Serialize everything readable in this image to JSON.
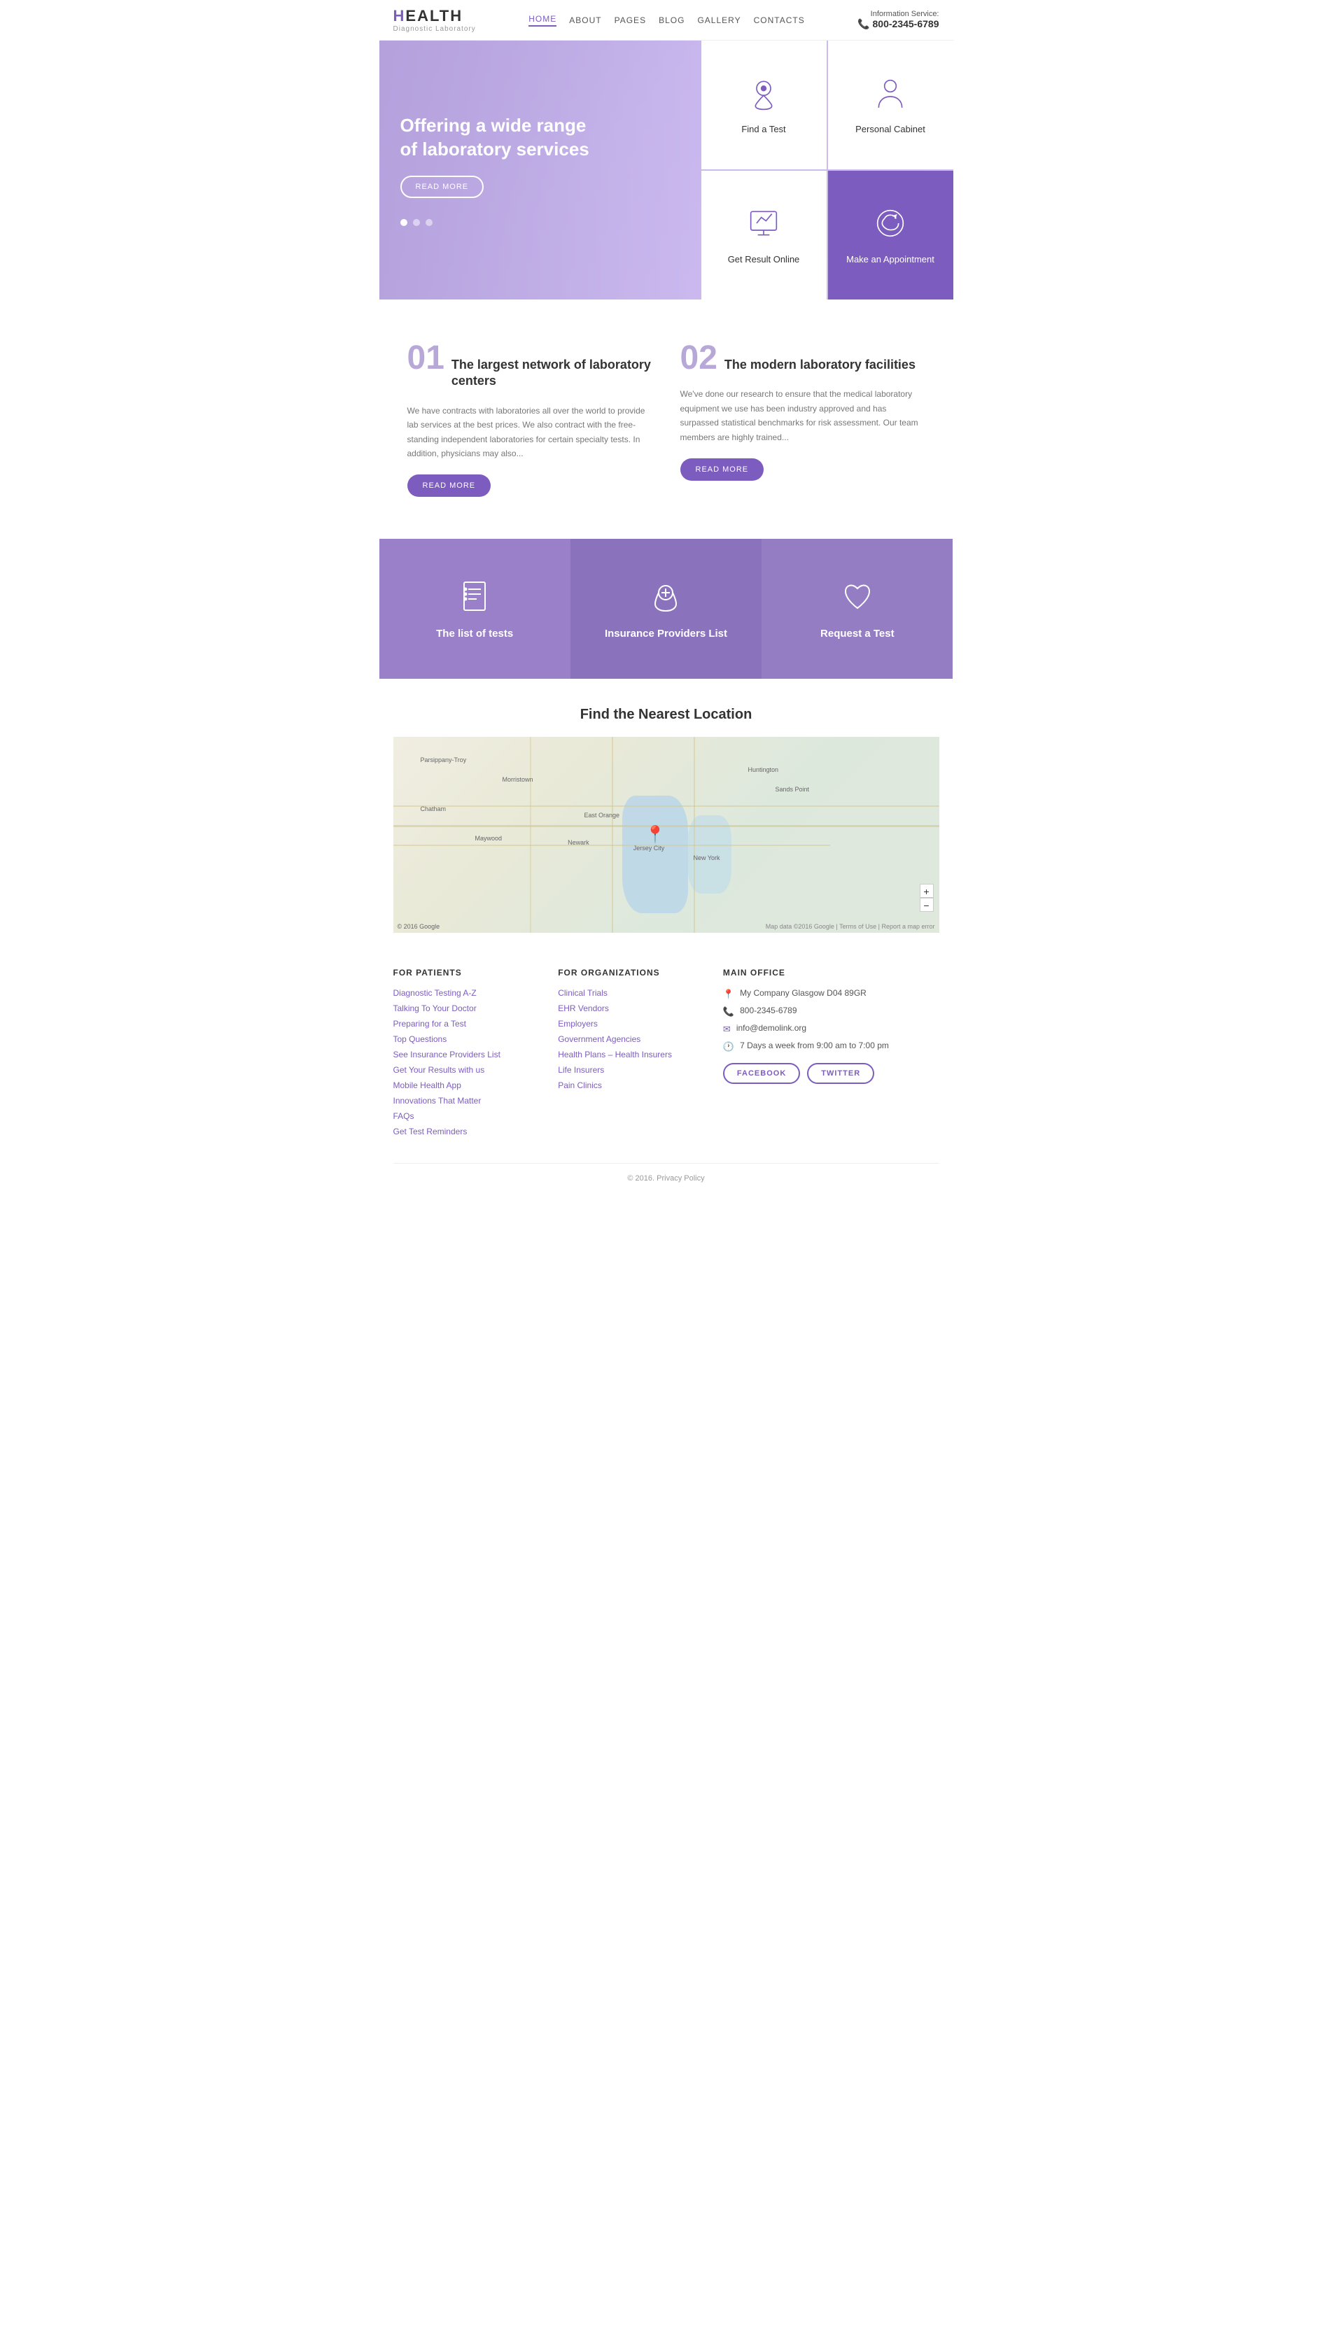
{
  "header": {
    "logo_main": "HEALTH",
    "logo_highlight": "H",
    "logo_sub": "Diagnostic Laboratory",
    "info_label": "Information Service:",
    "phone": "800-2345-6789",
    "nav": [
      {
        "label": "HOME",
        "active": true
      },
      {
        "label": "ABOUT",
        "active": false
      },
      {
        "label": "PAGES",
        "active": false
      },
      {
        "label": "BLOG",
        "active": false
      },
      {
        "label": "GALLERY",
        "active": false
      },
      {
        "label": "CONTACTS",
        "active": false
      }
    ]
  },
  "hero": {
    "title": "Offering a wide range of laboratory services",
    "btn_label": "READ MORE",
    "cards": [
      {
        "label": "Find a Test",
        "icon": "📍"
      },
      {
        "label": "Personal Cabinet",
        "icon": "👤"
      },
      {
        "label": "Get Result Online",
        "icon": "🖥"
      },
      {
        "label": "Make an Appointment",
        "icon": "📞"
      }
    ]
  },
  "features": [
    {
      "num": "01",
      "title": "The largest network of laboratory centers",
      "text": "We have contracts with laboratories all over the world to provide lab services at the best prices. We also contract with the free-standing independent laboratories for certain specialty tests. In addition, physicians may also...",
      "btn": "READ MORE"
    },
    {
      "num": "02",
      "title": "The modern laboratory facilities",
      "text": "We've done our research to ensure that the medical laboratory equipment we use has been industry approved and has surpassed statistical benchmarks for risk assessment. Our team members are highly trained...",
      "btn": "READ MORE"
    }
  ],
  "services": [
    {
      "label": "The list of tests",
      "icon": "📋"
    },
    {
      "label": "Insurance Providers List",
      "icon": "💰"
    },
    {
      "label": "Request a Test",
      "icon": "❤"
    }
  ],
  "map_section": {
    "title": "Find the Nearest Location"
  },
  "footer": {
    "col1_title": "FOR PATIENTS",
    "col1_links": [
      "Diagnostic Testing A-Z",
      "Talking To Your Doctor",
      "Preparing for a Test",
      "Top Questions",
      "See Insurance Providers List",
      "Get Your Results with us",
      "Mobile Health App",
      "Innovations That Matter",
      "FAQs",
      "Get Test Reminders"
    ],
    "col2_title": "FOR ORGANIZATIONS",
    "col2_links": [
      "Clinical Trials",
      "EHR Vendors",
      "Employers",
      "Government Agencies",
      "Health Plans – Health Insurers",
      "Life Insurers",
      "Pain Clinics"
    ],
    "col3_title": "MAIN OFFICE",
    "office_address": "My Company Glasgow D04 89GR",
    "office_phone": "800-2345-6789",
    "office_email": "info@demolink.org",
    "office_hours": "7 Days a week from 9:00 am to 7:00 pm",
    "social_facebook": "FACEBOOK",
    "social_twitter": "TWITTER",
    "copyright": "© 2016. Privacy Policy"
  }
}
